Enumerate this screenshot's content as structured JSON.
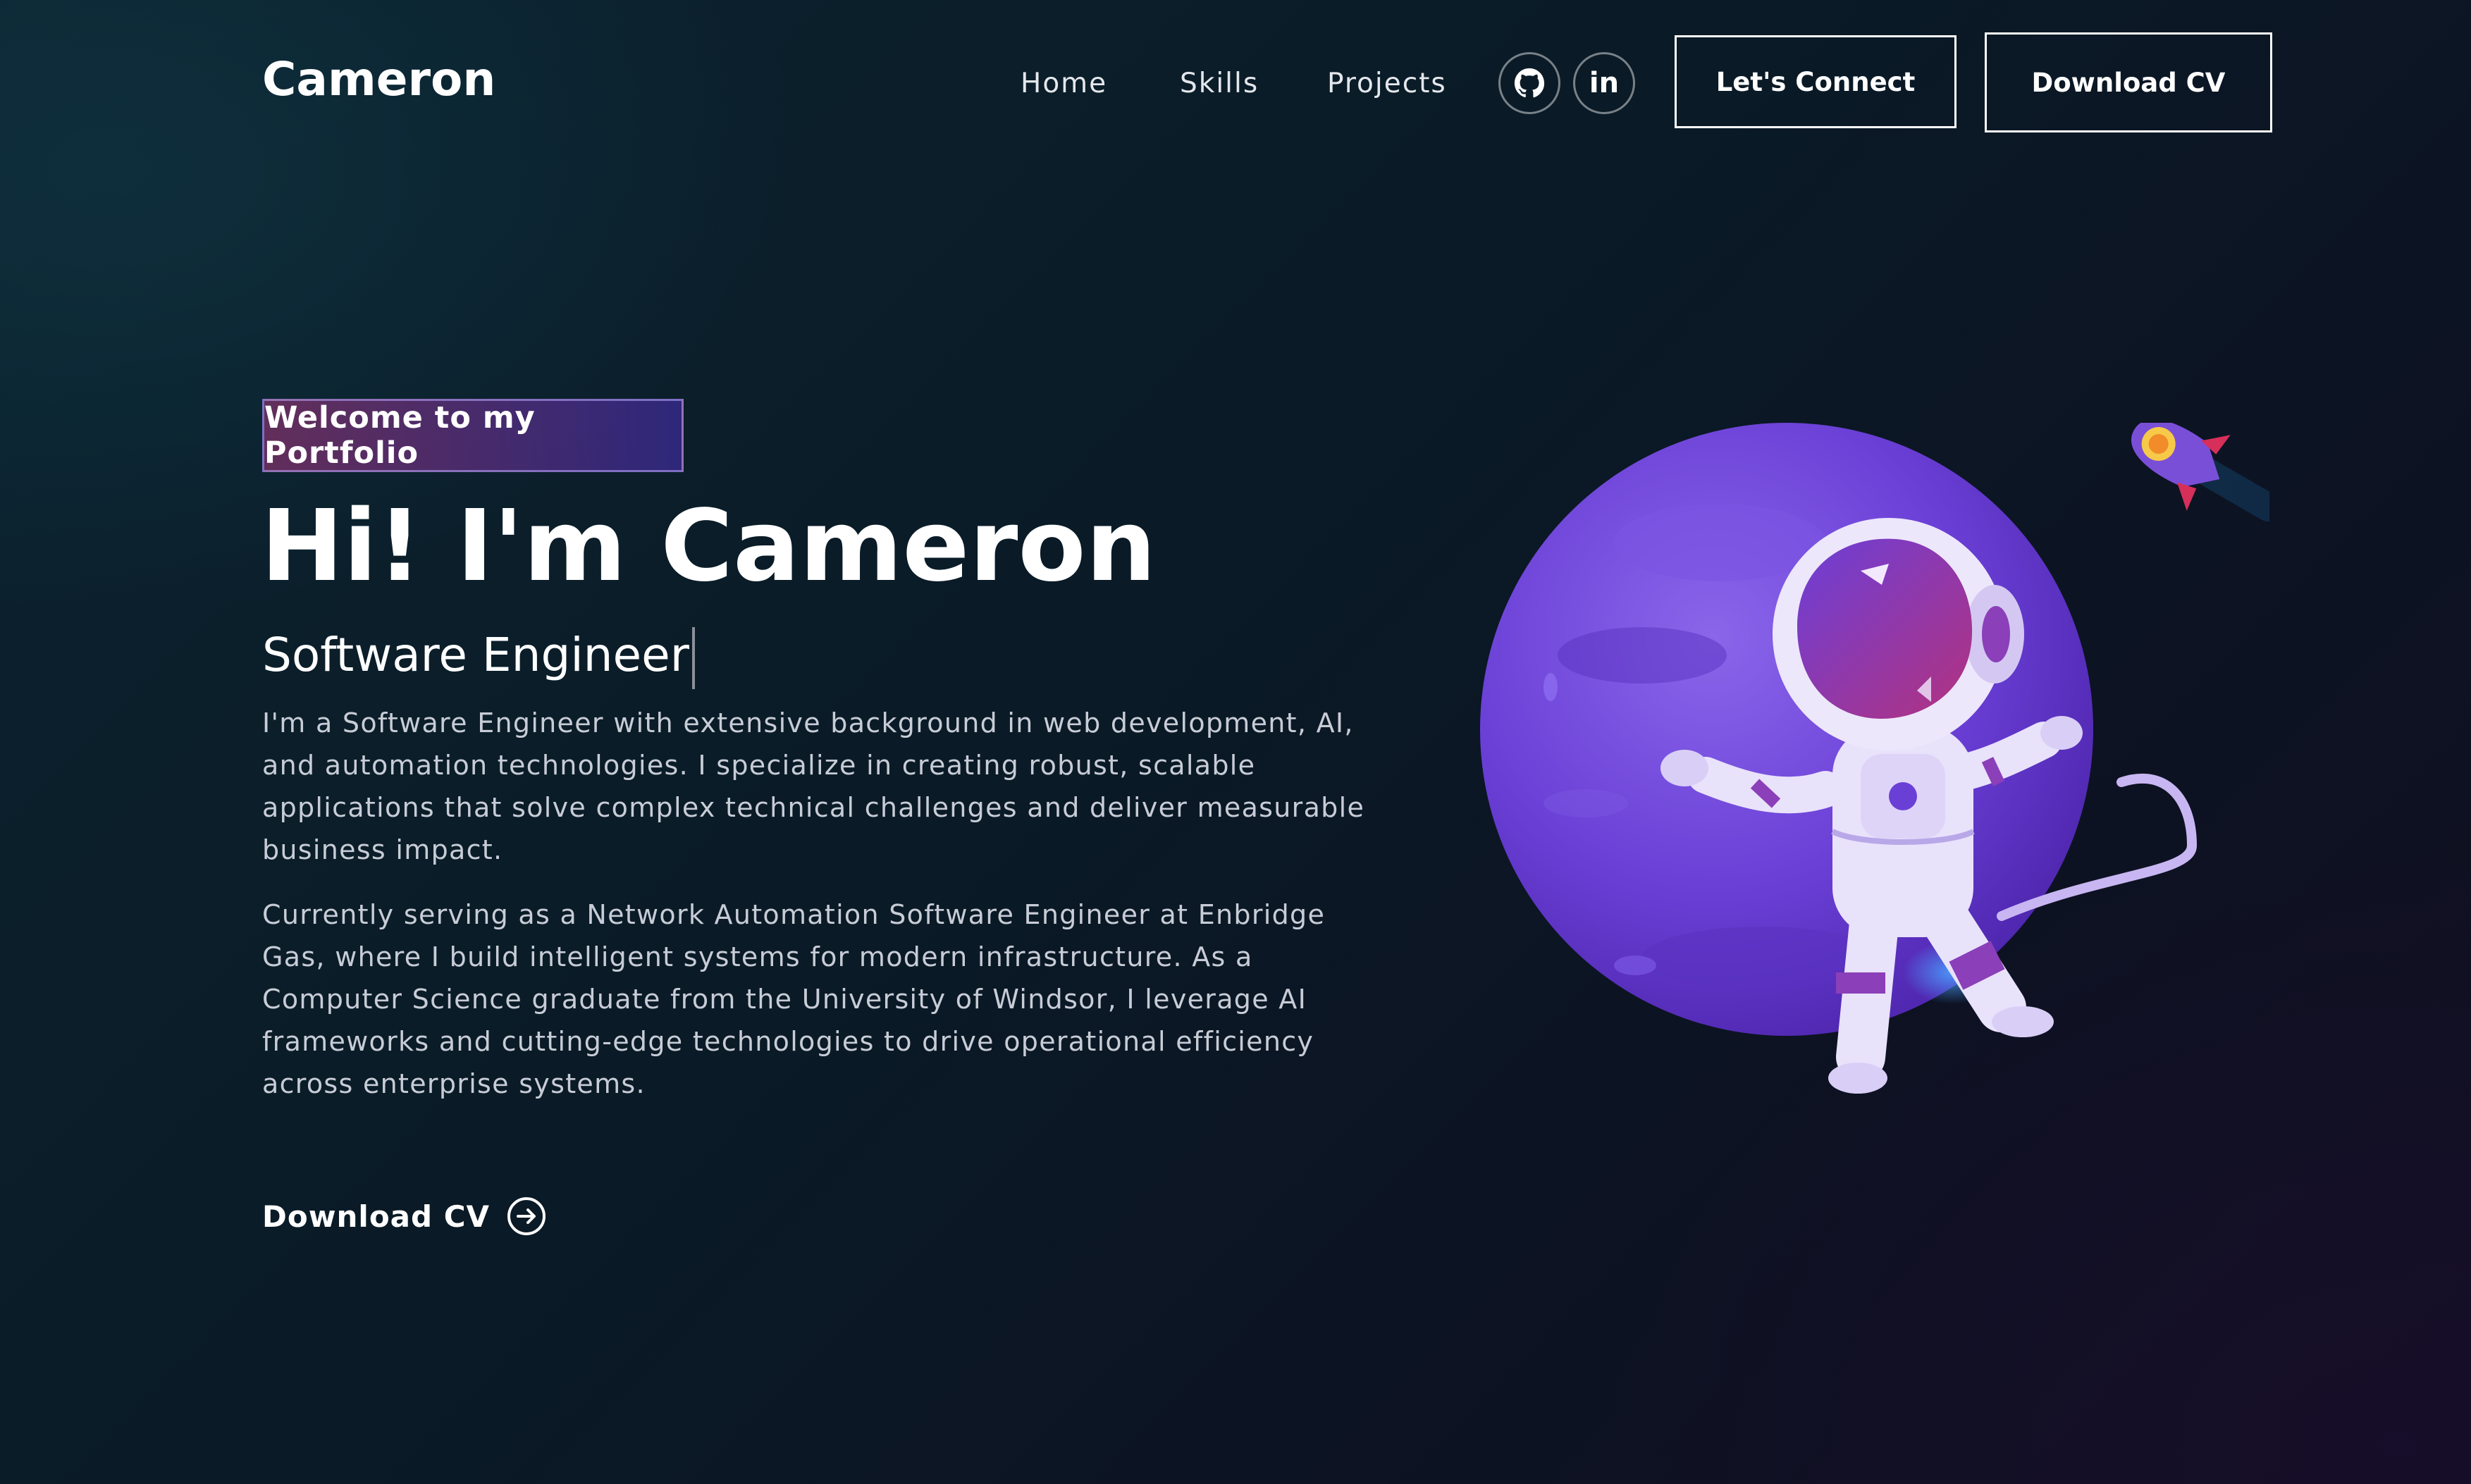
{
  "header": {
    "brand": "Cameron",
    "nav": [
      {
        "label": "Home"
      },
      {
        "label": "Skills"
      },
      {
        "label": "Projects"
      }
    ],
    "social": [
      {
        "icon": "github-icon"
      },
      {
        "icon": "linkedin-icon",
        "glyph": "in"
      }
    ],
    "connect_label": "Let's Connect",
    "download_label": "Download CV"
  },
  "hero": {
    "tagline": "Welcome to my Portfolio",
    "headline": "Hi! I'm Cameron",
    "role": "Software Engineer",
    "paragraphs": [
      "I'm a Software Engineer with extensive background in web development, AI, and automation technologies. I specialize in creating robust, scalable applications that solve complex technical challenges and deliver measurable business impact.",
      "Currently serving as a Network Automation Software Engineer at Enbridge Gas, where I build intelligent systems for modern infrastructure. As a Computer Science graduate from the University of Windsor, I leverage AI frameworks and cutting-edge technologies to drive operational efficiency across enterprise systems."
    ],
    "cta_label": "Download CV",
    "cta_icon": "arrow-right-circle-icon"
  },
  "theme": {
    "background_dark": "#0a1a26",
    "accent_purple": "#6a3fd6",
    "accent_magenta": "#aa367c",
    "text_muted": "#c7ccd6"
  }
}
